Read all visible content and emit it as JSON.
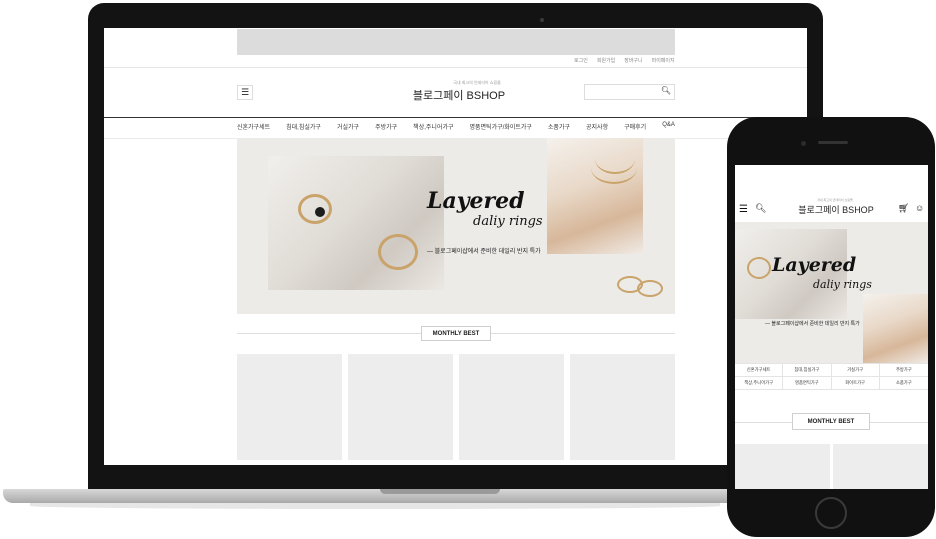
{
  "desktop": {
    "top_links": [
      "로그인",
      "회원가입",
      "장바구니",
      "마이페이지"
    ],
    "tagline": "국내 최고의 인테리어 쇼핑몰",
    "logo": "블로그페이 BSHOP",
    "search": {
      "placeholder": ""
    },
    "nav": [
      "신혼가구세트",
      "침대,침실가구",
      "거실가구",
      "주방가구",
      "책상,주니어가구",
      "명품면틱가구/화이트가구",
      "소품가구",
      "공지사항",
      "구매후기",
      "Q&A"
    ],
    "hero": {
      "title_line1": "Layered",
      "title_line2": "daliy rings",
      "subtitle": "— 블로그페이샵에서 준비한 데일리 반지 특가"
    },
    "section_title": "MONTHLY BEST",
    "product_count": 4
  },
  "mobile": {
    "tagline": "국내 최고의 인테리어 쇼핑몰",
    "logo": "블로그페이 BSHOP",
    "hero": {
      "title_line1": "Layered",
      "title_line2": "daliy rings",
      "subtitle": "— 블로그페이샵에서 준비한 데일리 반지 특가"
    },
    "categories": [
      "신혼가구세트",
      "침대,침실가구",
      "거실가구",
      "주방가구",
      "책상,주니어가구",
      "명품면틱가구",
      "화이트가구",
      "소품가구"
    ],
    "section_title": "MONTHLY BEST"
  },
  "icons": [
    "menu-icon",
    "search-icon",
    "cart-icon",
    "user-icon"
  ],
  "colors": {
    "device": "#111111",
    "accent_gold": "#c9a36a",
    "placeholder": "#ededed"
  }
}
